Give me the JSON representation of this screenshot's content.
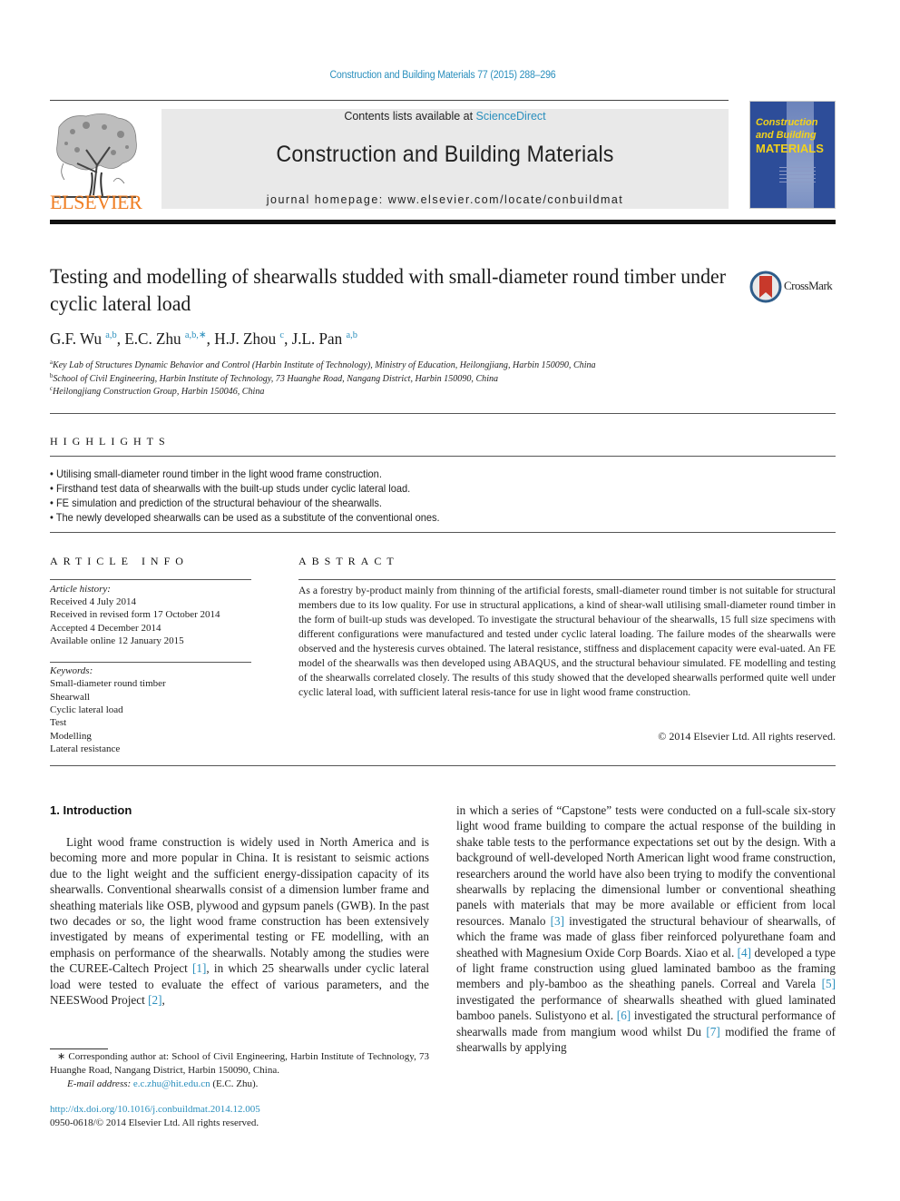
{
  "header": {
    "journal_ref": "Construction and Building Materials 77 (2015) 288–296",
    "contents_prefix": "Contents lists available at ",
    "contents_link": "ScienceDirect",
    "journal_title": "Construction and Building Materials",
    "homepage_label": "journal homepage: www.elsevier.com/locate/conbuildmat",
    "publisher_logo": "ELSEVIER",
    "cover": {
      "line1": "Construction",
      "line2": "and Building",
      "line3": "MATERIALS"
    },
    "colors": {
      "link": "#2a8fbd",
      "elsevier_orange": "#f07f24",
      "cover_blue": "#2d4d99",
      "cover_yellow": "#f3d21a"
    }
  },
  "article": {
    "title": "Testing and modelling of shearwalls studded with small-diameter round timber under cyclic lateral load",
    "crossmark_label": "CrossMark",
    "authors": [
      {
        "name": "G.F. Wu",
        "sup": "a,b"
      },
      {
        "name": "E.C. Zhu",
        "sup": "a,b,∗"
      },
      {
        "name": "H.J. Zhou",
        "sup": "c"
      },
      {
        "name": "J.L. Pan",
        "sup": "a,b"
      }
    ],
    "affiliations": [
      {
        "key": "a",
        "text": "Key Lab of Structures Dynamic Behavior and Control (Harbin Institute of Technology), Ministry of Education, Heilongjiang, Harbin 150090, China"
      },
      {
        "key": "b",
        "text": "School of Civil Engineering, Harbin Institute of Technology, 73 Huanghe Road, Nangang District, Harbin 150090, China"
      },
      {
        "key": "c",
        "text": "Heilongjiang Construction Group, Harbin 150046, China"
      }
    ]
  },
  "highlights": {
    "heading": "HIGHLIGHTS",
    "items": [
      "Utilising small-diameter round timber in the light wood frame construction.",
      "Firsthand test data of shearwalls with the built-up studs under cyclic lateral load.",
      "FE simulation and prediction of the structural behaviour of the shearwalls.",
      "The newly developed shearwalls can be used as a substitute of the conventional ones."
    ]
  },
  "article_info": {
    "heading": "ARTICLE INFO",
    "history_label": "Article history:",
    "history": [
      "Received 4 July 2014",
      "Received in revised form 17 October 2014",
      "Accepted 4 December 2014",
      "Available online 12 January 2015"
    ],
    "keywords_label": "Keywords:",
    "keywords": [
      "Small-diameter round timber",
      "Shearwall",
      "Cyclic lateral load",
      "Test",
      "Modelling",
      "Lateral resistance"
    ]
  },
  "abstract": {
    "heading": "ABSTRACT",
    "text": "As a forestry by-product mainly from thinning of the artificial forests, small-diameter round timber is not suitable for structural members due to its low quality. For use in structural applications, a kind of shear-wall utilising small-diameter round timber in the form of built-up studs was developed. To investigate the structural behaviour of the shearwalls, 15 full size specimens with different configurations were manufactured and tested under cyclic lateral loading. The failure modes of the shearwalls were observed and the hysteresis curves obtained. The lateral resistance, stiffness and displacement capacity were eval-uated. An FE model of the shearwalls was then developed using ABAQUS, and the structural behaviour simulated. FE modelling and testing of the shearwalls correlated closely. The results of this study showed that the developed shearwalls performed quite well under cyclic lateral load, with sufficient lateral resis-tance for use in light wood frame construction.",
    "copyright": "© 2014 Elsevier Ltd. All rights reserved."
  },
  "introduction": {
    "heading": "1. Introduction",
    "left": [
      {
        "t": "Light wood frame construction is widely used in North America and is becoming more and more popular in China. It is resistant to seismic actions due to the light weight and the sufficient energy-dissipation capacity of its shearwalls. Conventional shearwalls consist of a dimension lumber frame and sheathing materials like OSB, plywood and gypsum panels (GWB). In the past two decades or so, the light wood frame construction has been extensively investigated by means of experimental testing or FE modelling, with an emphasis on performance of the shearwalls. Notably among the studies were the CUREE-Caltech Project "
      },
      {
        "ref": "[1]"
      },
      {
        "t": ", in which 25 shearwalls under cyclic lateral load were tested to evaluate the effect of various parameters, and the NEESWood Project "
      },
      {
        "ref": "[2]"
      },
      {
        "t": ","
      }
    ],
    "right": [
      {
        "t": "in which a series of “Capstone” tests were conducted on a full-scale six-story light wood frame building to compare the actual response of the building in shake table tests to the performance expectations set out by the design. With a background of well-developed North American light wood frame construction, researchers around the world have also been trying to modify the conventional shearwalls by replacing the dimensional lumber or conventional sheathing panels with materials that may be more available or efficient from local resources. Manalo "
      },
      {
        "ref": "[3]"
      },
      {
        "t": " investigated the structural behaviour of shearwalls, of which the frame was made of glass fiber reinforced polyurethane foam and sheathed with Magnesium Oxide Corp Boards. Xiao et al. "
      },
      {
        "ref": "[4]"
      },
      {
        "t": " developed a type of light frame construction using glued laminated bamboo as the framing members and ply-bamboo as the sheathing panels. Correal and Varela "
      },
      {
        "ref": "[5]"
      },
      {
        "t": " investigated the performance of shearwalls sheathed with glued laminated bamboo panels. Sulistyono et al. "
      },
      {
        "ref": "[6]"
      },
      {
        "t": " investigated the structural performance of shearwalls made from mangium wood whilst Du "
      },
      {
        "ref": "[7]"
      },
      {
        "t": " modified the frame of shearwalls by applying"
      }
    ]
  },
  "footnotes": {
    "corresponding": "∗ Corresponding author at: School of Civil Engineering, Harbin Institute of Technology, 73 Huanghe Road, Nangang District, Harbin 150090, China.",
    "email_label": "E-mail address: ",
    "email": "e.c.zhu@hit.edu.cn",
    "email_suffix": " (E.C. Zhu).",
    "doi": "http://dx.doi.org/10.1016/j.conbuildmat.2014.12.005",
    "issn": "0950-0618/© 2014 Elsevier Ltd. All rights reserved."
  }
}
